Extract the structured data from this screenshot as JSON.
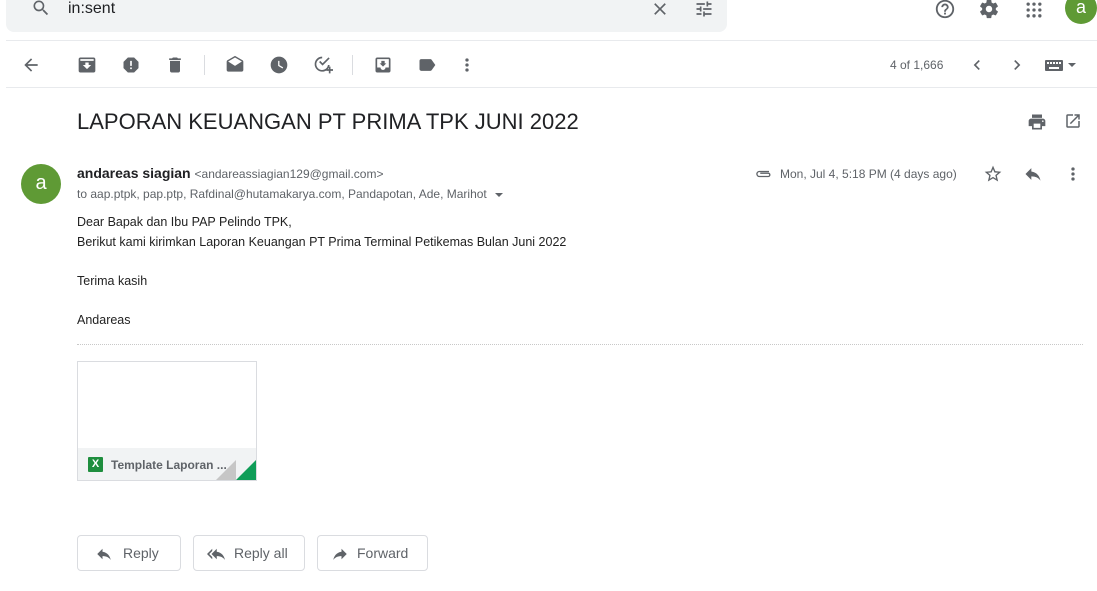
{
  "search": {
    "value": "in:sent"
  },
  "account": {
    "initial": "a"
  },
  "pager": {
    "text": "4 of 1,666"
  },
  "email": {
    "subject": "LAPORAN KEUANGAN PT PRIMA TPK JUNI 2022",
    "sender_initial": "a",
    "sender_name": "andareas siagian",
    "sender_email": "<andareassiagian129@gmail.com>",
    "to": "to aap.ptpk, pap.ptp, Rafdinal@hutamakarya.com, Pandapotan, Ade, Marihot",
    "date": "Mon, Jul 4, 5:18 PM (4 days ago)",
    "body": {
      "line1": "Dear Bapak dan Ibu PAP Pelindo TPK,",
      "line2": "Berikut kami kirimkan Laporan Keuangan PT Prima Terminal Petikemas Bulan Juni 2022",
      "line3": "Terima kasih",
      "line4": "Andareas"
    },
    "attachment": {
      "name": "Template Laporan ...",
      "type_letter": "X"
    }
  },
  "actions": {
    "reply": "Reply",
    "reply_all": "Reply all",
    "forward": "Forward"
  },
  "colors": {
    "avatar": "#5f9a35",
    "sheets_green": "#1e8e3e",
    "icon_gray": "#5f6368"
  }
}
